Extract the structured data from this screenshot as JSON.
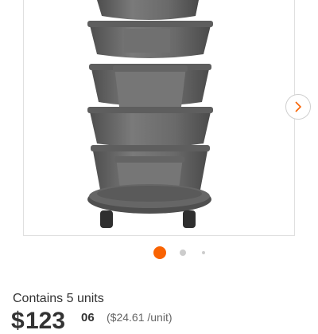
{
  "product": {
    "image_alt": "Stackable tower planter with rolling base",
    "gallery": {
      "active_index": 0,
      "dot_count": 3,
      "next_icon": "chevron-right-icon"
    },
    "units_text": "Contains 5 units",
    "price": {
      "currency": "$",
      "dollars": "123",
      "cents": "06",
      "unit_price": "($24.61 /unit)"
    }
  },
  "colors": {
    "accent": "#f96302",
    "planter": "#6b6b6b",
    "dot_inactive": "#cccccc"
  }
}
